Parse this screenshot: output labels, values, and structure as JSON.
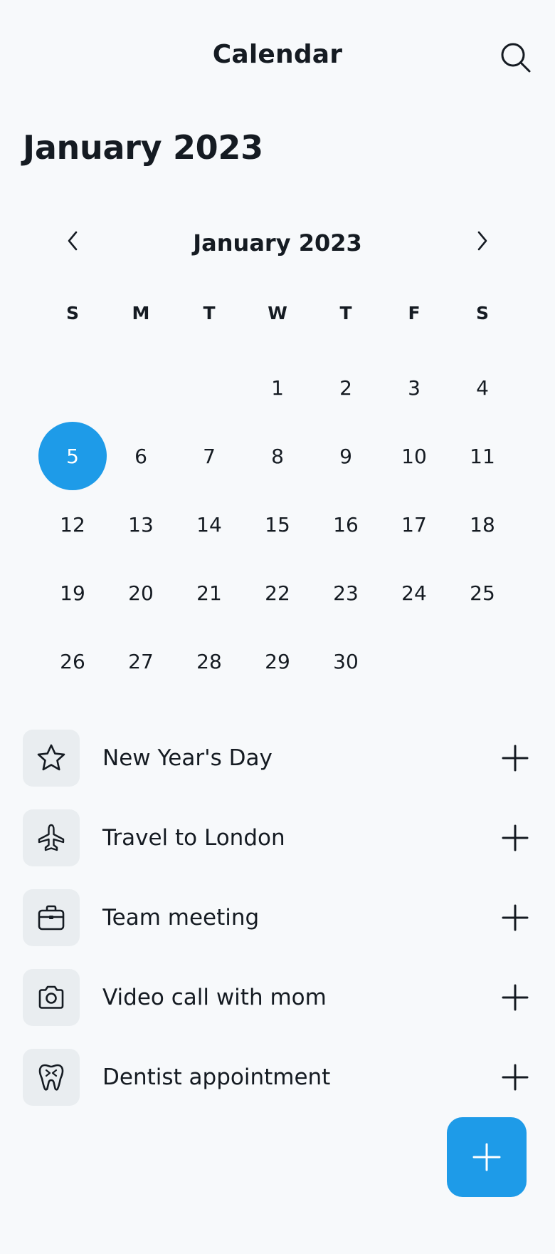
{
  "header": {
    "title": "Calendar",
    "search_icon": "search-icon"
  },
  "page_title": "January 2023",
  "calendar": {
    "month_label": "January 2023",
    "prev_icon": "chevron-left-icon",
    "next_icon": "chevron-right-icon",
    "weekdays": [
      "S",
      "M",
      "T",
      "W",
      "T",
      "F",
      "S"
    ],
    "days": [
      "",
      "",
      "",
      "1",
      "2",
      "3",
      "4",
      "5",
      "6",
      "7",
      "8",
      "9",
      "10",
      "11",
      "12",
      "13",
      "14",
      "15",
      "16",
      "17",
      "18",
      "19",
      "20",
      "21",
      "22",
      "23",
      "24",
      "25",
      "26",
      "27",
      "28",
      "29",
      "30",
      "",
      ""
    ],
    "selected_day": "5",
    "accent_color": "#1e9be8"
  },
  "events": [
    {
      "label": "New Year's Day",
      "icon": "star-icon"
    },
    {
      "label": "Travel to London",
      "icon": "airplane-icon"
    },
    {
      "label": "Team meeting",
      "icon": "briefcase-icon"
    },
    {
      "label": "Video call with mom",
      "icon": "camera-icon"
    },
    {
      "label": "Dentist appointment",
      "icon": "tooth-icon"
    }
  ],
  "event_add_icon": "plus-icon",
  "fab": {
    "icon": "plus-icon",
    "color": "#1e9be8"
  }
}
